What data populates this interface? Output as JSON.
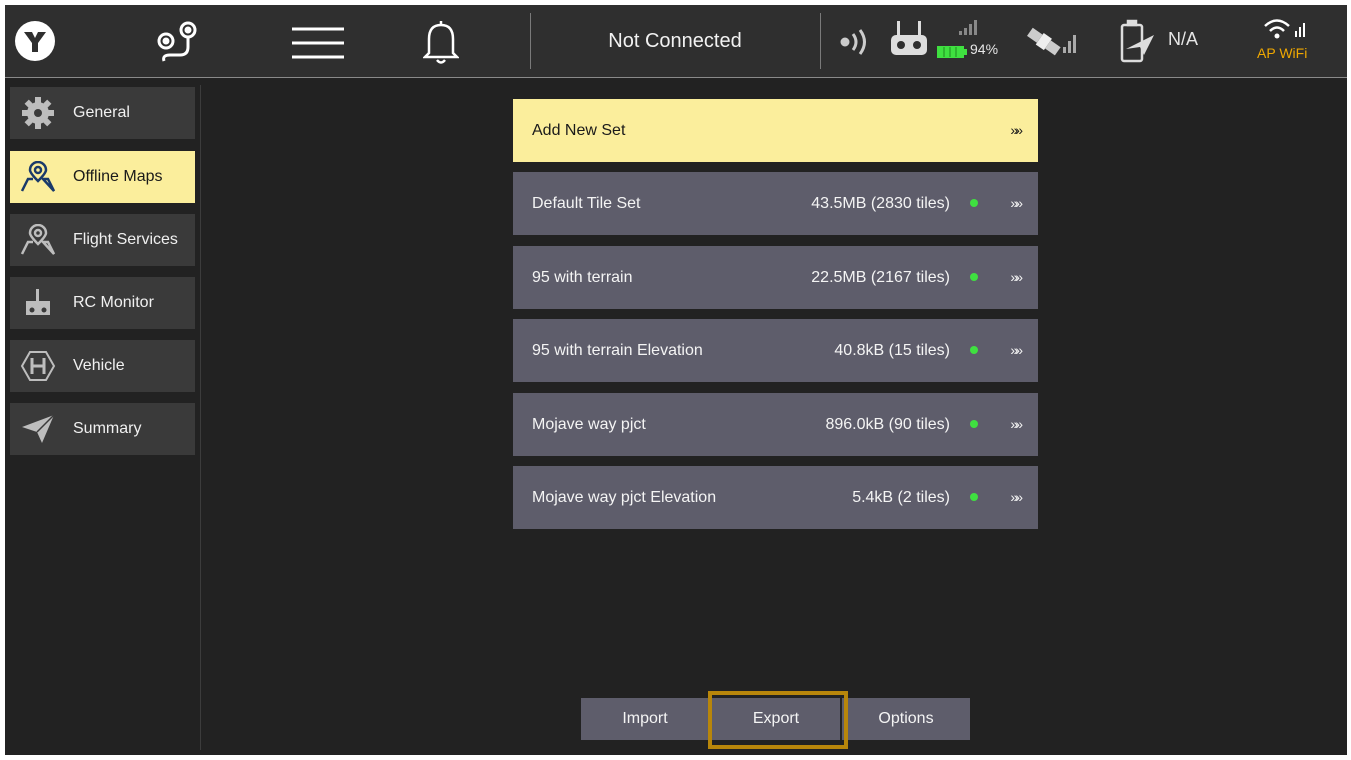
{
  "topbar": {
    "logo_icon": "app-logo-icon",
    "route_icon": "route-pin-icon",
    "menu_icon": "hamburger-menu-icon",
    "bell_icon": "notification-bell-icon",
    "status_text": "Not Connected",
    "battery_percent": "94%",
    "vehicle_battery_text": "N/A",
    "wifi_label": "AP WiFi",
    "colors": {
      "accent": "#fbee9c",
      "wifi": "#f0a800",
      "good": "#3fe040"
    }
  },
  "sidebar": {
    "items": [
      {
        "label": "General",
        "icon": "gear-icon",
        "active": false
      },
      {
        "label": "Offline Maps",
        "icon": "map-pin-icon",
        "active": true
      },
      {
        "label": "Flight Services",
        "icon": "map-pin-icon",
        "active": false
      },
      {
        "label": "RC Monitor",
        "icon": "remote-controller-icon",
        "active": false
      },
      {
        "label": "Vehicle",
        "icon": "helipad-icon",
        "active": false
      },
      {
        "label": "Summary",
        "icon": "paper-plane-icon",
        "active": false
      }
    ]
  },
  "sets": {
    "add_label": "Add New Set",
    "chevron": "»»",
    "items": [
      {
        "name": "Default Tile Set",
        "size": "43.5MB (2830 tiles)"
      },
      {
        "name": "95 with terrain",
        "size": "22.5MB (2167 tiles)"
      },
      {
        "name": "95 with terrain Elevation",
        "size": "40.8kB (15 tiles)"
      },
      {
        "name": "Mojave way pjct",
        "size": "896.0kB (90 tiles)"
      },
      {
        "name": "Mojave way pjct Elevation",
        "size": "5.4kB (2 tiles)"
      }
    ]
  },
  "actions": {
    "import_label": "Import",
    "export_label": "Export",
    "options_label": "Options"
  }
}
